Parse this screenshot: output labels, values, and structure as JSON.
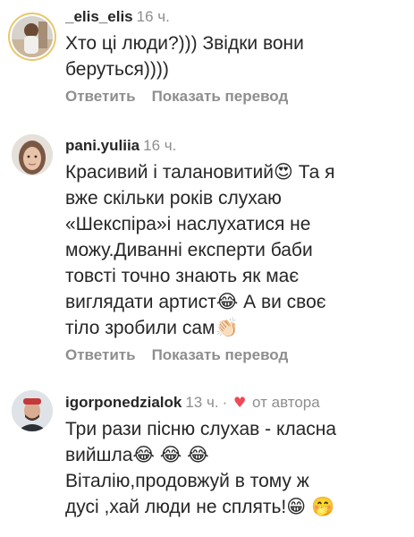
{
  "comments": [
    {
      "username": "_elis_elis",
      "time": "16 ч.",
      "lines": [
        "Хто ці люди?))) Звідки вони",
        "беруться))))"
      ],
      "actions": {
        "reply": "Ответить",
        "translate": "Показать перевод"
      },
      "avatar": "avatar-photo"
    },
    {
      "username": "pani.yuliia",
      "time": "16 ч.",
      "lines": [
        "Красивий і талановитий😍 Та я",
        "вже скільки років слухаю",
        "«Шекспіра»і наслухатися не",
        "можу.Диванні експерти баби",
        "товсті точно знають як має",
        "виглядати артист😂 А ви своє",
        "тіло зробили сам👏🏻"
      ],
      "actions": {
        "reply": "Ответить",
        "translate": "Показать перевод"
      },
      "avatar": "avatar-photo"
    },
    {
      "username": "igorponedzialok",
      "time": "13 ч.",
      "heart": "♥",
      "author_label": "от автора",
      "lines": [
        "Три рази пісню слухав - класна",
        "вийшла😂 😂 😂",
        "Віталію,продовжуй в  тому ж",
        "дусі ,хай люди не сплять!😁 🤭"
      ],
      "avatar": "avatar-photo"
    }
  ],
  "colors": {
    "text": "#262626",
    "secondary": "#8e8e8e",
    "heart": "#ed4956"
  }
}
